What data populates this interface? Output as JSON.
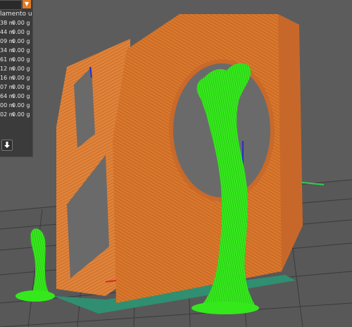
{
  "stats": {
    "header": "lamento usato",
    "rows": [
      {
        "length": "38 m",
        "weight": "0.00 g"
      },
      {
        "length": "44 m",
        "weight": "0.00 g"
      },
      {
        "length": "09 m",
        "weight": "0.00 g"
      },
      {
        "length": "34 m",
        "weight": "0.00 g"
      },
      {
        "length": "61 m",
        "weight": "0.00 g"
      },
      {
        "length": "12 m",
        "weight": "0.00 g"
      },
      {
        "length": "16 m",
        "weight": "0.00 g"
      },
      {
        "length": "07 m",
        "weight": "0.00 g"
      },
      {
        "length": "64 m",
        "weight": "0.00 g"
      },
      {
        "length": "00 m",
        "weight": "0.00 g"
      },
      {
        "length": "02 m",
        "weight": "0.00 g"
      }
    ]
  },
  "icons": {
    "dropdown": "chevron-down-icon",
    "export": "download-arrow-icon"
  },
  "colors": {
    "model_orange": "#e07d2e",
    "support_green": "#2ee01a",
    "bed_grey": "#585858",
    "bed_grid": "#3a3a3a",
    "panel": "#3b3b3b",
    "accent": "#e47b22"
  }
}
